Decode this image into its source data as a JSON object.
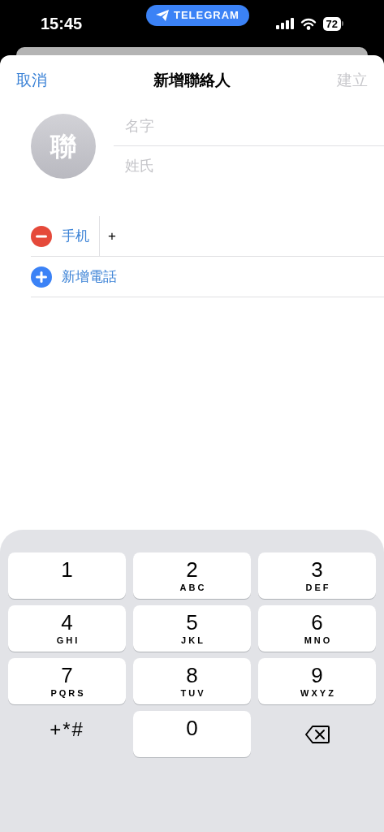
{
  "status_bar": {
    "time": "15:45",
    "app_pill": "TELEGRAM",
    "battery": "72"
  },
  "nav": {
    "cancel": "取消",
    "title": "新增聯絡人",
    "create": {
      "label": "建立",
      "disabled": true
    }
  },
  "avatar": {
    "initial": "聯"
  },
  "fields": [
    {
      "placeholder": "名字"
    },
    {
      "placeholder": "姓氏"
    }
  ],
  "phones": [
    {
      "kind": "remove",
      "label": "手机",
      "value": "+"
    },
    {
      "kind": "add",
      "label": "新增電話"
    }
  ],
  "keypad": [
    {
      "kind": "digit",
      "digit": "1"
    },
    {
      "kind": "digit",
      "digit": "2",
      "letters": "ABC"
    },
    {
      "kind": "digit",
      "digit": "3",
      "letters": "DEF"
    },
    {
      "kind": "digit",
      "digit": "4",
      "letters": "GHI"
    },
    {
      "kind": "digit",
      "digit": "5",
      "letters": "JKL"
    },
    {
      "kind": "digit",
      "digit": "6",
      "letters": "MNO"
    },
    {
      "kind": "digit",
      "digit": "7",
      "letters": "PQRS"
    },
    {
      "kind": "digit",
      "digit": "8",
      "letters": "TUV"
    },
    {
      "kind": "digit",
      "digit": "9",
      "letters": "WXYZ"
    },
    {
      "kind": "symbols",
      "label": "+*#"
    },
    {
      "kind": "digit",
      "digit": "0"
    },
    {
      "kind": "backspace"
    }
  ]
}
